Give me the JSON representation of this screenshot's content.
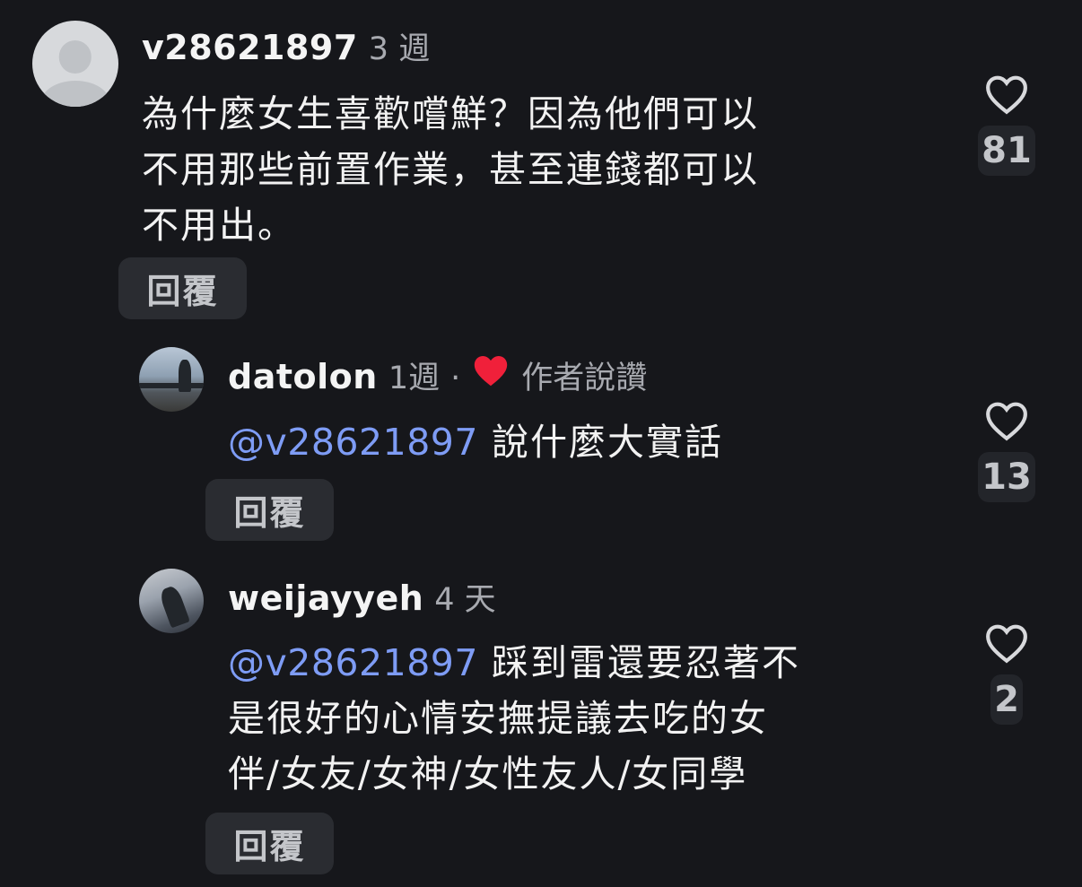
{
  "comments": [
    {
      "username": "v28621897",
      "time": "3 週",
      "text": "為什麼女生喜歡嚐鮮？因為他們可以\n不用那些前置作業，甚至連錢都可以\n不用出。",
      "reply_label": "回覆",
      "likes": "81"
    },
    {
      "username": "datolon",
      "time": "1週",
      "dot": "·",
      "liked_by_author": "作者說讚",
      "mention": "@v28621897",
      "text": " 說什麼大實話",
      "reply_label": "回覆",
      "likes": "13"
    },
    {
      "username": "weijayyeh",
      "time": "4 天",
      "mention": "@v28621897",
      "text_line1": " 踩到雷還要忍著不",
      "text_rest": "是很好的心情安撫提議去吃的女\n伴/女友/女神/女性友人/女同學",
      "reply_label": "回覆",
      "likes": "2"
    }
  ],
  "icons": {
    "like": "heart-outline-icon",
    "author_like": "heart-filled-icon",
    "avatar_default": "default-avatar-icon"
  },
  "colors": {
    "background": "#16171b",
    "mention": "#7e9cf5",
    "heart": "#f0203a",
    "secondary_text": "#a8aab0"
  }
}
